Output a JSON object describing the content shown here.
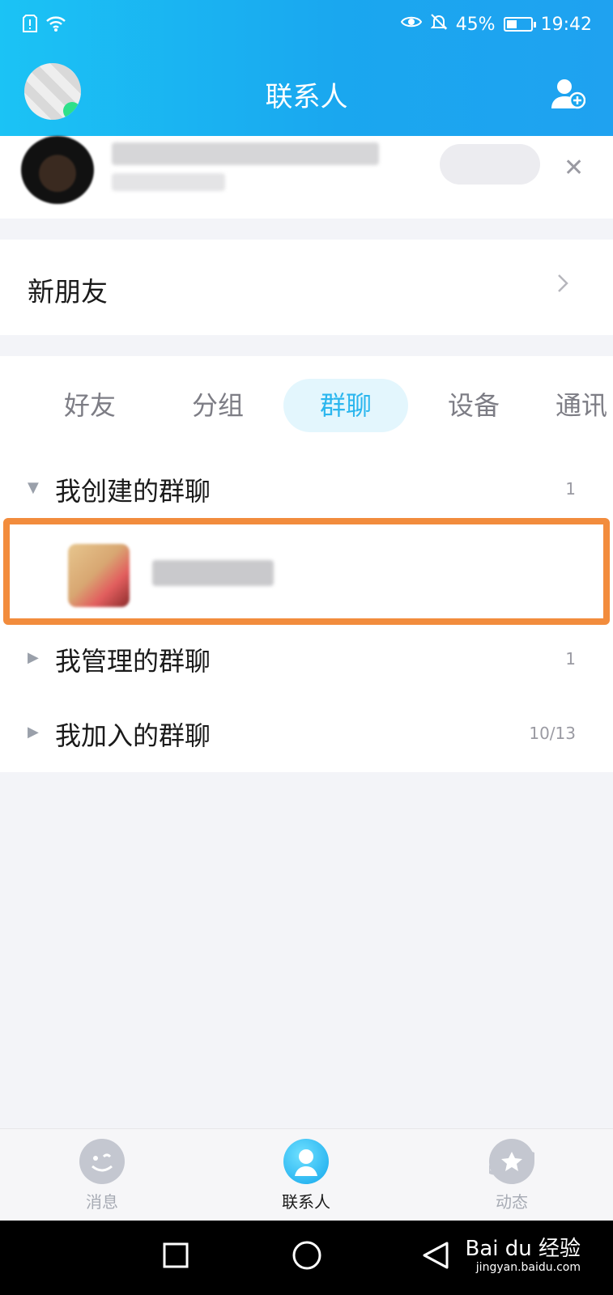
{
  "status_bar": {
    "battery_percent": "45%",
    "battery_level": 0.45,
    "time": "19:42"
  },
  "header": {
    "title": "联系人"
  },
  "new_friends": {
    "label": "新朋友"
  },
  "tabs": [
    {
      "label": "好友",
      "active": false
    },
    {
      "label": "分组",
      "active": false
    },
    {
      "label": "群聊",
      "active": true
    },
    {
      "label": "设备",
      "active": false
    },
    {
      "label": "通讯",
      "active": false
    }
  ],
  "groups": [
    {
      "name": "我创建的群聊",
      "count": "1",
      "expanded": true
    },
    {
      "name": "我管理的群聊",
      "count": "1",
      "expanded": false
    },
    {
      "name": "我加入的群聊",
      "count": "10/13",
      "expanded": false
    }
  ],
  "bottom_tabs": [
    {
      "label": "消息",
      "icon": "message-smile-icon",
      "active": false
    },
    {
      "label": "联系人",
      "icon": "contacts-person-icon",
      "active": true
    },
    {
      "label": "动态",
      "icon": "planet-star-icon",
      "active": false
    }
  ],
  "colors": {
    "accent": "#1aa7ef",
    "highlight_border": "#f28c3d",
    "active_tab_text": "#2bb6ee"
  },
  "watermark": {
    "brand": "Bai du 经验",
    "url": "jingyan.baidu.com"
  }
}
